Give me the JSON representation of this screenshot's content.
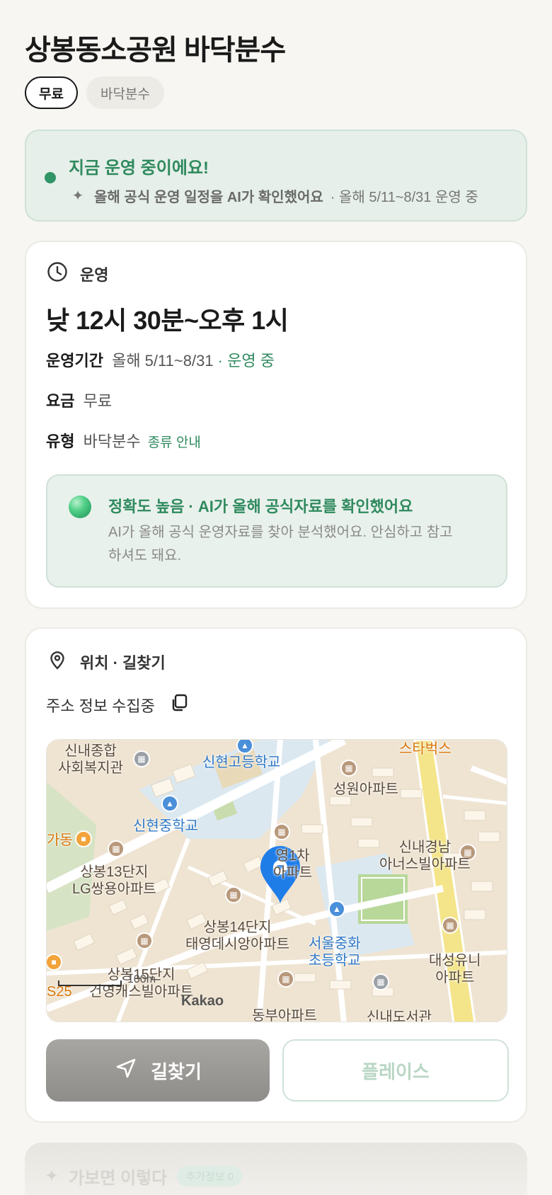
{
  "title": "상봉동소공원 바닥분수",
  "tags": [
    "무료",
    "바닥분수"
  ],
  "status": {
    "title": "지금 운영 중이에요!",
    "sub_strong": "올해 공식 운영 일정을 AI가 확인했어요",
    "sub_rest": "· 올해 5/11~8/31 운영 중",
    "dot_color": "#2f9466"
  },
  "operation": {
    "heading": "운영",
    "time": "낮 12시 30분~오후 1시",
    "period_label": "운영기간",
    "period_value": "올해 5/11~8/31",
    "period_status": "· 운영 중",
    "fee_label": "요금",
    "fee_value": "무료",
    "type_label": "유형",
    "type_value": "바닥분수",
    "type_link": "종류 안내",
    "ai_title": "정확도 높음 · AI가 올해 공식자료를 확인했어요",
    "ai_desc": "AI가 올해 공식 운영자료를 찾아 분석했어요. 안심하고 참고하셔도 돼요."
  },
  "location": {
    "heading": "위치 · 길찾기",
    "address": "주소 정보 수집중",
    "map": {
      "labels": {
        "welfare": "신내종합\n사회복지관",
        "high_school": "신현고등학교",
        "starbucks": "스타벅스",
        "seongwon": "성원아파트",
        "middle_school": "신현중학교",
        "gadong": "가동",
        "apt1": "영1차\n아파트",
        "shinnae_gyeongnam": "신내경남\n아너스빌아파트",
        "sangbong13": "상봉13단지\nLG쌍용아파트",
        "sangbong14": "상봉14단지\n태영데시앙아파트",
        "elementary": "서울중화\n초등학교",
        "daesung": "대성유니\n아파트",
        "sangbong15": "상봉15단지\n건영캐스빌아파트",
        "s25": "S25",
        "dongbu": "동부아파트",
        "library": "신내도서관"
      },
      "scale": "100m",
      "brand": "Kakao",
      "pin_color": "#1f7de8"
    },
    "route_button": "길찾기",
    "place_button": "플레이스"
  },
  "next_section": {
    "title": "가보면 이렇다",
    "badge": "추가정보 0"
  }
}
